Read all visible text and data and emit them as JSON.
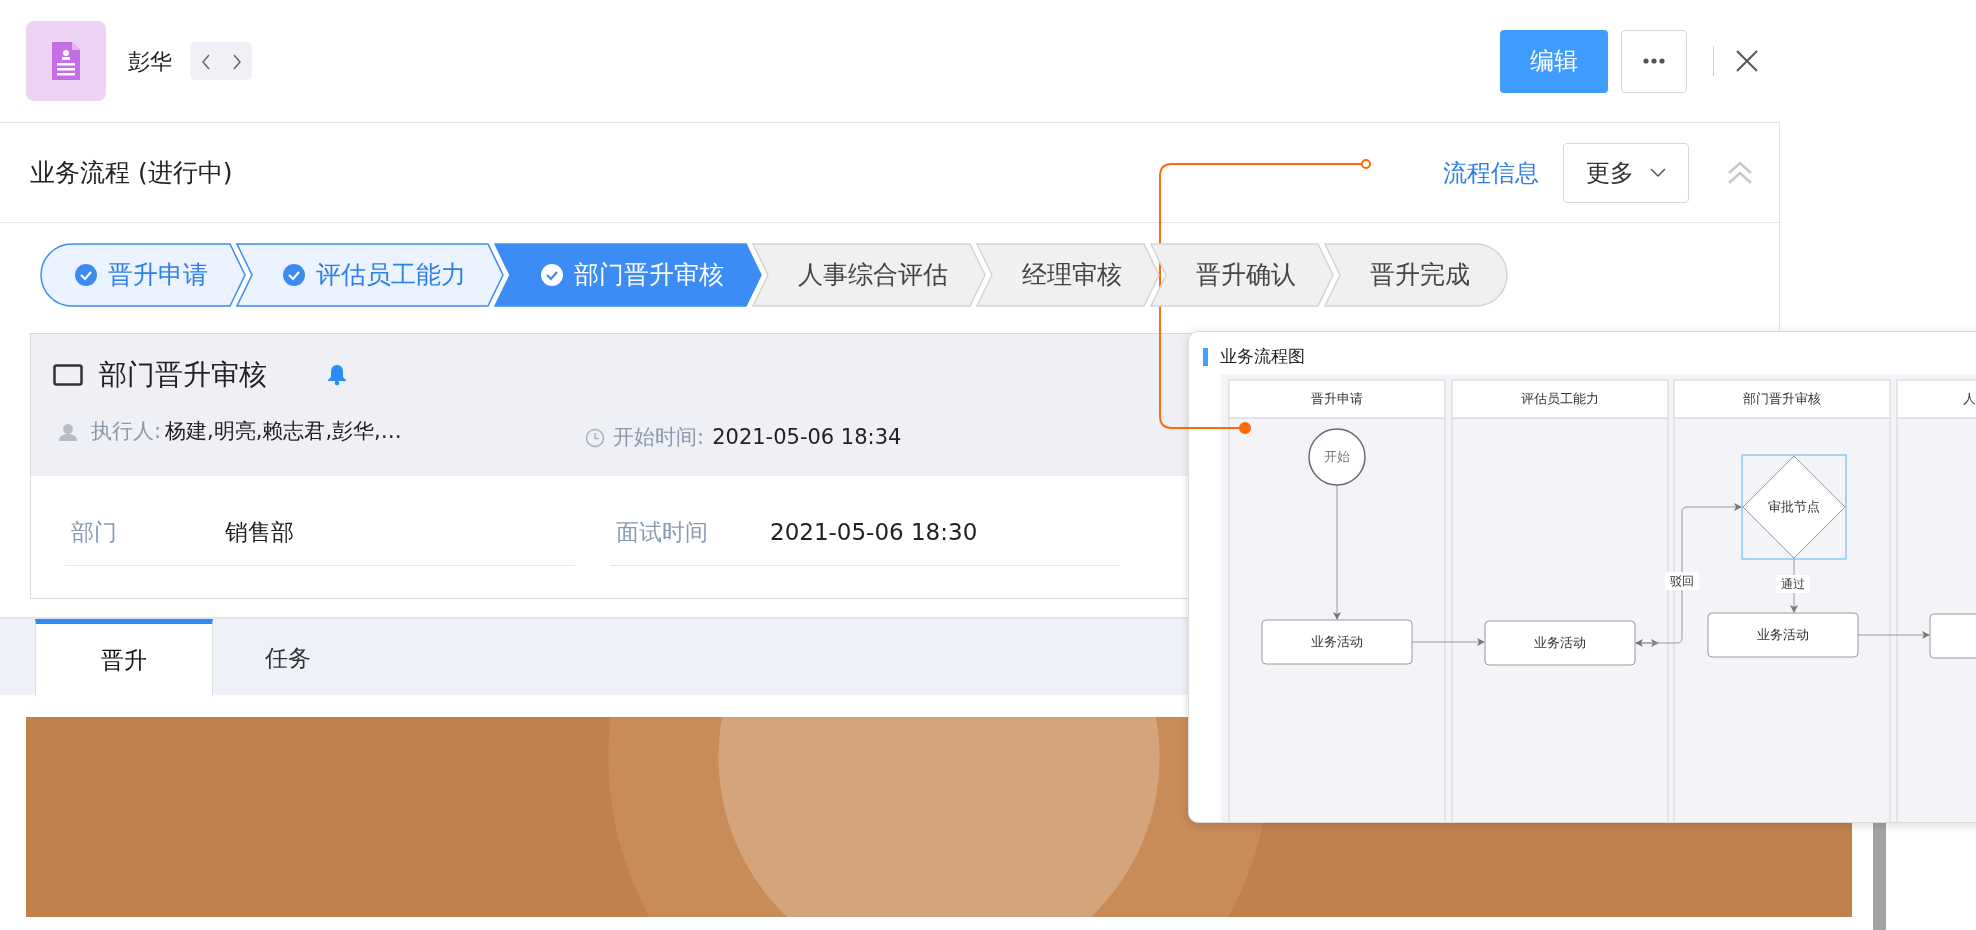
{
  "header": {
    "title": "彭华",
    "edit_button": "编辑"
  },
  "process": {
    "title": "业务流程 (进行中)",
    "info_link": "流程信息",
    "more_button": "更多",
    "steps": [
      {
        "label": "晋升申请",
        "completed": true,
        "selected": false
      },
      {
        "label": "评估员工能力",
        "completed": true,
        "selected": false
      },
      {
        "label": "部门晋升审核",
        "completed": true,
        "selected": true
      },
      {
        "label": "人事综合评估",
        "completed": false,
        "selected": false
      },
      {
        "label": "经理审核",
        "completed": false,
        "selected": false
      },
      {
        "label": "晋升确认",
        "completed": false,
        "selected": false
      },
      {
        "label": "晋升完成",
        "completed": false,
        "selected": false
      }
    ]
  },
  "task_card": {
    "title": "部门晋升审核",
    "assignee_label": "执行人:",
    "assignees": "杨建,明亮,赖志君,彭华,…",
    "start_label": "开始时间:",
    "start_time": "2021-05-06 18:34",
    "fields": [
      {
        "label": "部门",
        "value": "销售部"
      },
      {
        "label": "面试时间",
        "value": "2021-05-06 18:30"
      }
    ]
  },
  "tabs": [
    {
      "label": "晋升",
      "selected": true
    },
    {
      "label": "任务",
      "selected": false
    }
  ],
  "flow_popup": {
    "title": "业务流程图",
    "lanes": [
      "晋升申请",
      "评估员工能力",
      "部门晋升审核",
      "人"
    ],
    "nodes": [
      {
        "kind": "start",
        "text": "开始",
        "selected": false
      },
      {
        "kind": "activity",
        "text": "业务活动",
        "selected": false
      },
      {
        "kind": "activity",
        "text": "业务活动",
        "selected": false
      },
      {
        "kind": "decision",
        "text": "审批节点",
        "selected": true
      },
      {
        "kind": "activity",
        "text": "业务活动",
        "selected": false
      },
      {
        "kind": "activity",
        "selected": false
      }
    ],
    "edge_labels": [
      "驳回",
      "通过"
    ]
  }
}
